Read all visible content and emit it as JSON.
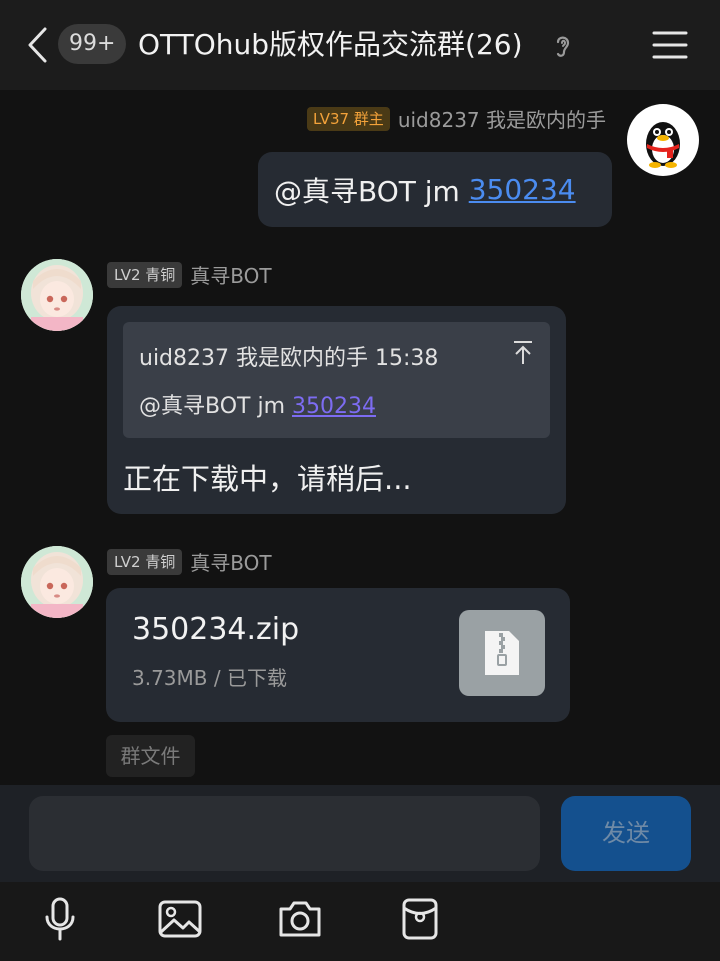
{
  "header": {
    "unread_count": "99+",
    "title": "OTTOhub版权作品交流群(26)"
  },
  "messages": {
    "self": {
      "badge": "LV37 群主",
      "name": "uid8237 我是欧内的手",
      "text_prefix": "@真寻BOT jm ",
      "link": "350234"
    },
    "reply": {
      "badge": "LV2 青铜",
      "name": "真寻BOT",
      "quote_header": "uid8237 我是欧内的手 15:38",
      "quote_text_prefix": "@真寻BOT jm ",
      "quote_link": "350234",
      "text": "正在下载中，请稍后..."
    },
    "file": {
      "badge": "LV2 青铜",
      "name": "真寻BOT",
      "file_name": "350234.zip",
      "file_info": "3.73MB / 已下载"
    },
    "group_file_tag": "群文件"
  },
  "input": {
    "value": "",
    "send_label": "发送"
  },
  "toolbar": {
    "icons": [
      "microphone-icon",
      "image-icon",
      "camera-icon",
      "red-packet-icon"
    ]
  },
  "colors": {
    "link": "#4b8cf0",
    "owner_badge": "#f3a23a",
    "send_button": "#14508e"
  }
}
